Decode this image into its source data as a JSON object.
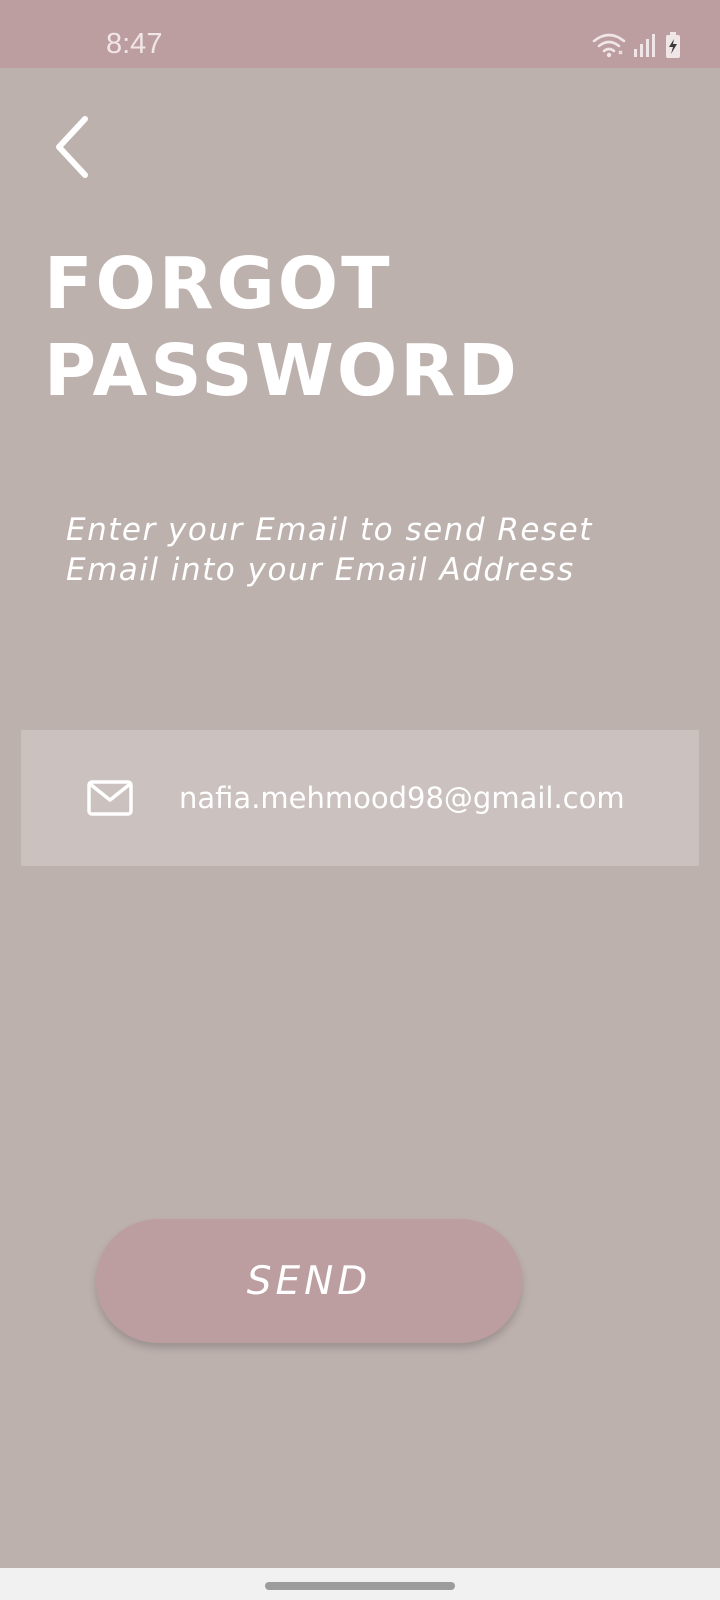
{
  "status_bar": {
    "time": "8:47",
    "icons": [
      "wifi-icon",
      "signal-icon",
      "battery-charging-icon"
    ]
  },
  "header": {
    "back_icon": "chevron-left-icon"
  },
  "title": {
    "line1": "FORGOT",
    "line2": "PASSWORD"
  },
  "subtitle": {
    "line1": "Enter your Email to send Reset",
    "line2": "Email into your Email Address"
  },
  "email_field": {
    "icon": "mail-icon",
    "value": "nafia.mehmood98@gmail.com"
  },
  "send_button": {
    "label": "SEND"
  },
  "colors": {
    "background": "#bdb1ae",
    "accent": "#bd9ea0",
    "field_background": "#cbc1be",
    "text": "#ffffff"
  }
}
